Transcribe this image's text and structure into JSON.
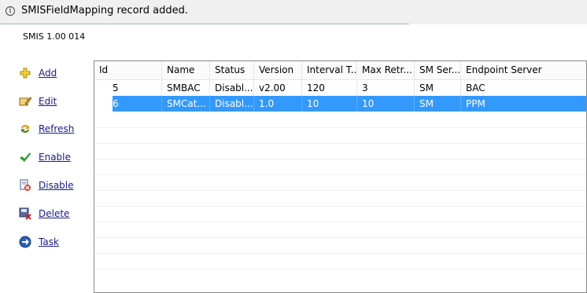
{
  "notification": {
    "text": "SMISFieldMapping record added.",
    "icon": "info-icon"
  },
  "subtitle": "SMIS 1.00 014",
  "sidebar": {
    "items": [
      {
        "label": "Add",
        "icon": "add-icon"
      },
      {
        "label": "Edit",
        "icon": "edit-icon"
      },
      {
        "label": "Refresh",
        "icon": "refresh-icon"
      },
      {
        "label": "Enable",
        "icon": "enable-check-icon"
      },
      {
        "label": "Disable",
        "icon": "disable-icon"
      },
      {
        "label": "Delete",
        "icon": "delete-icon"
      },
      {
        "label": "Task",
        "icon": "task-arrow-icon"
      }
    ]
  },
  "table": {
    "columns": [
      "Id",
      "Name",
      "Status",
      "Version",
      "Interval T...",
      "Max Retr...",
      "SM Ser...",
      "Endpoint Server"
    ],
    "rows": [
      {
        "cells": [
          "5",
          "SMBAC",
          "Disabl...",
          "v2.00",
          "120",
          "3",
          "SM",
          "BAC"
        ],
        "selected": false
      },
      {
        "cells": [
          "6",
          "SMCat...",
          "Disabl...",
          "1.0",
          "10",
          "10",
          "SM",
          "PPM"
        ],
        "selected": true
      }
    ]
  },
  "colors": {
    "selection": "#3399ff",
    "link": "#1a1a8c"
  }
}
